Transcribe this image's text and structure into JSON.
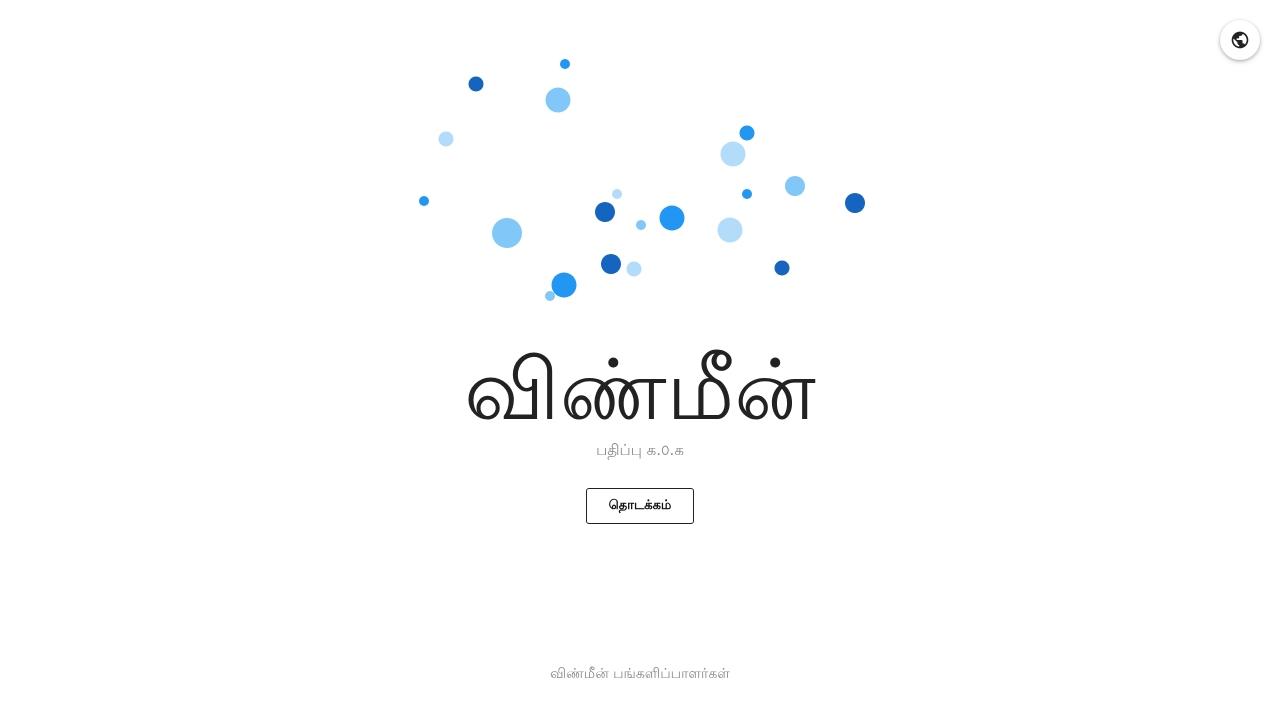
{
  "app": {
    "title": "விண்மீன்",
    "version": "பதிப்பு க.௦.க",
    "start_label": "தொடக்கம்",
    "footer_link": "விண்மீன் பங்களிப்பாளர்கள்",
    "language_icon": "globe-icon"
  },
  "colors": {
    "dark_blue": "#1565c0",
    "blue": "#2196f3",
    "light_blue": "#81c7f8",
    "pale_blue": "#b3dcfb",
    "text_dark": "#222222",
    "text_muted": "#888888"
  }
}
